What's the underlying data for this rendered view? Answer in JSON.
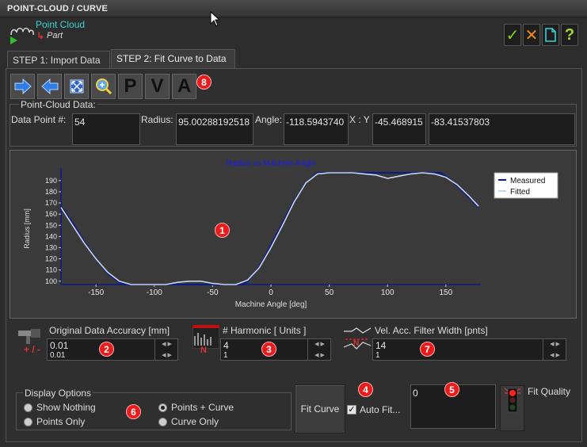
{
  "window": {
    "title": "POINT-CLOUD / CURVE"
  },
  "header": {
    "main_label": "Point Cloud",
    "sub_label": "Part"
  },
  "top_buttons": {
    "ok": "✓",
    "cancel": "✕",
    "new": "",
    "help": "?"
  },
  "tabs": [
    {
      "label": "STEP 1: Import Data",
      "active": false
    },
    {
      "label": "STEP 2: Fit Curve to Data",
      "active": true
    }
  ],
  "toolbar": {
    "letters": [
      "P",
      "V",
      "A"
    ],
    "badge": "8"
  },
  "point_cloud": {
    "group_label": "Point-Cloud Data:",
    "data_point_label": "Data Point #:",
    "data_point_value": "54",
    "radius_label": "Radius:",
    "radius_value": "95.00288192518",
    "angle_label": "Angle:",
    "angle_value": "-118.5943740",
    "xy_label": "X : Y",
    "x_value": "-45.468915",
    "y_value": "-83.41537803"
  },
  "chart_data": {
    "type": "line",
    "title": "Radius vs Machine Angle",
    "xlabel": "Machine Angle [deg]",
    "ylabel": "Radius [mm]",
    "xlim": [
      -180,
      180
    ],
    "ylim": [
      97,
      197
    ],
    "xticks": [
      -150,
      -100,
      -50,
      0,
      50,
      100,
      150
    ],
    "yticks": [
      100,
      110,
      120,
      130,
      140,
      150,
      160,
      170,
      180,
      190
    ],
    "legend_position": "top-right",
    "series": [
      {
        "name": "Measured",
        "color": "#0a1a8a",
        "x": [
          -180,
          -170,
          -160,
          -150,
          -140,
          -130,
          -125,
          -120,
          -100,
          -80,
          -60,
          -40,
          -30,
          -25,
          -20,
          -10,
          0,
          10,
          20,
          30,
          40,
          50,
          60,
          80,
          100,
          120,
          140,
          145,
          150,
          160,
          170,
          178
        ],
        "y": [
          167,
          152,
          135,
          120,
          107,
          99,
          97,
          97,
          97,
          97,
          97,
          97,
          97,
          97,
          100,
          113,
          132,
          152,
          172,
          188,
          197,
          197,
          197,
          197,
          197,
          197,
          197,
          197,
          194,
          185,
          175,
          166
        ]
      },
      {
        "name": "Fitted",
        "color": "#c8d8ea",
        "x": [
          -180,
          -170,
          -160,
          -150,
          -140,
          -130,
          -120,
          -110,
          -100,
          -90,
          -80,
          -70,
          -60,
          -50,
          -40,
          -30,
          -20,
          -10,
          0,
          10,
          20,
          30,
          40,
          50,
          60,
          70,
          80,
          90,
          100,
          110,
          120,
          130,
          140,
          150,
          160,
          170,
          178
        ],
        "y": [
          166,
          150,
          134,
          120,
          108,
          100,
          97,
          97,
          97,
          97,
          99,
          100,
          100,
          98,
          97,
          97,
          101,
          112,
          130,
          150,
          171,
          188,
          196,
          197,
          197,
          197,
          196,
          195,
          192,
          194,
          196,
          197,
          196,
          193,
          186,
          176,
          167
        ]
      }
    ]
  },
  "accuracy": {
    "label": "Original Data Accuracy [mm]",
    "value": "0.01",
    "sub_value": "0.01",
    "badge": "2",
    "icon_text": "+ / -"
  },
  "harmonic": {
    "label": "# Harmonic [ Units ]",
    "value": "4",
    "sub_value": "1",
    "badge": "3",
    "icon_text": "N"
  },
  "filter": {
    "label": "Vel. Acc. Filter Width [pnts]",
    "value": "14",
    "sub_value": "1",
    "badge": "7",
    "icon_text": "N"
  },
  "chart_badge": "1",
  "display_options": {
    "group_label": "Display Options",
    "options": [
      {
        "label": "Show Nothing",
        "selected": false
      },
      {
        "label": "Points Only",
        "selected": false
      },
      {
        "label": "Points + Curve",
        "selected": true
      },
      {
        "label": "Curve Only",
        "selected": false
      }
    ],
    "badge": "6"
  },
  "fit": {
    "button_label": "Fit Curve",
    "auto_fit_label": "Auto Fit...",
    "auto_fit_checked": true,
    "badge": "4",
    "result_value": "0",
    "result_badge": "5",
    "quality_label": "Fit Quality"
  }
}
